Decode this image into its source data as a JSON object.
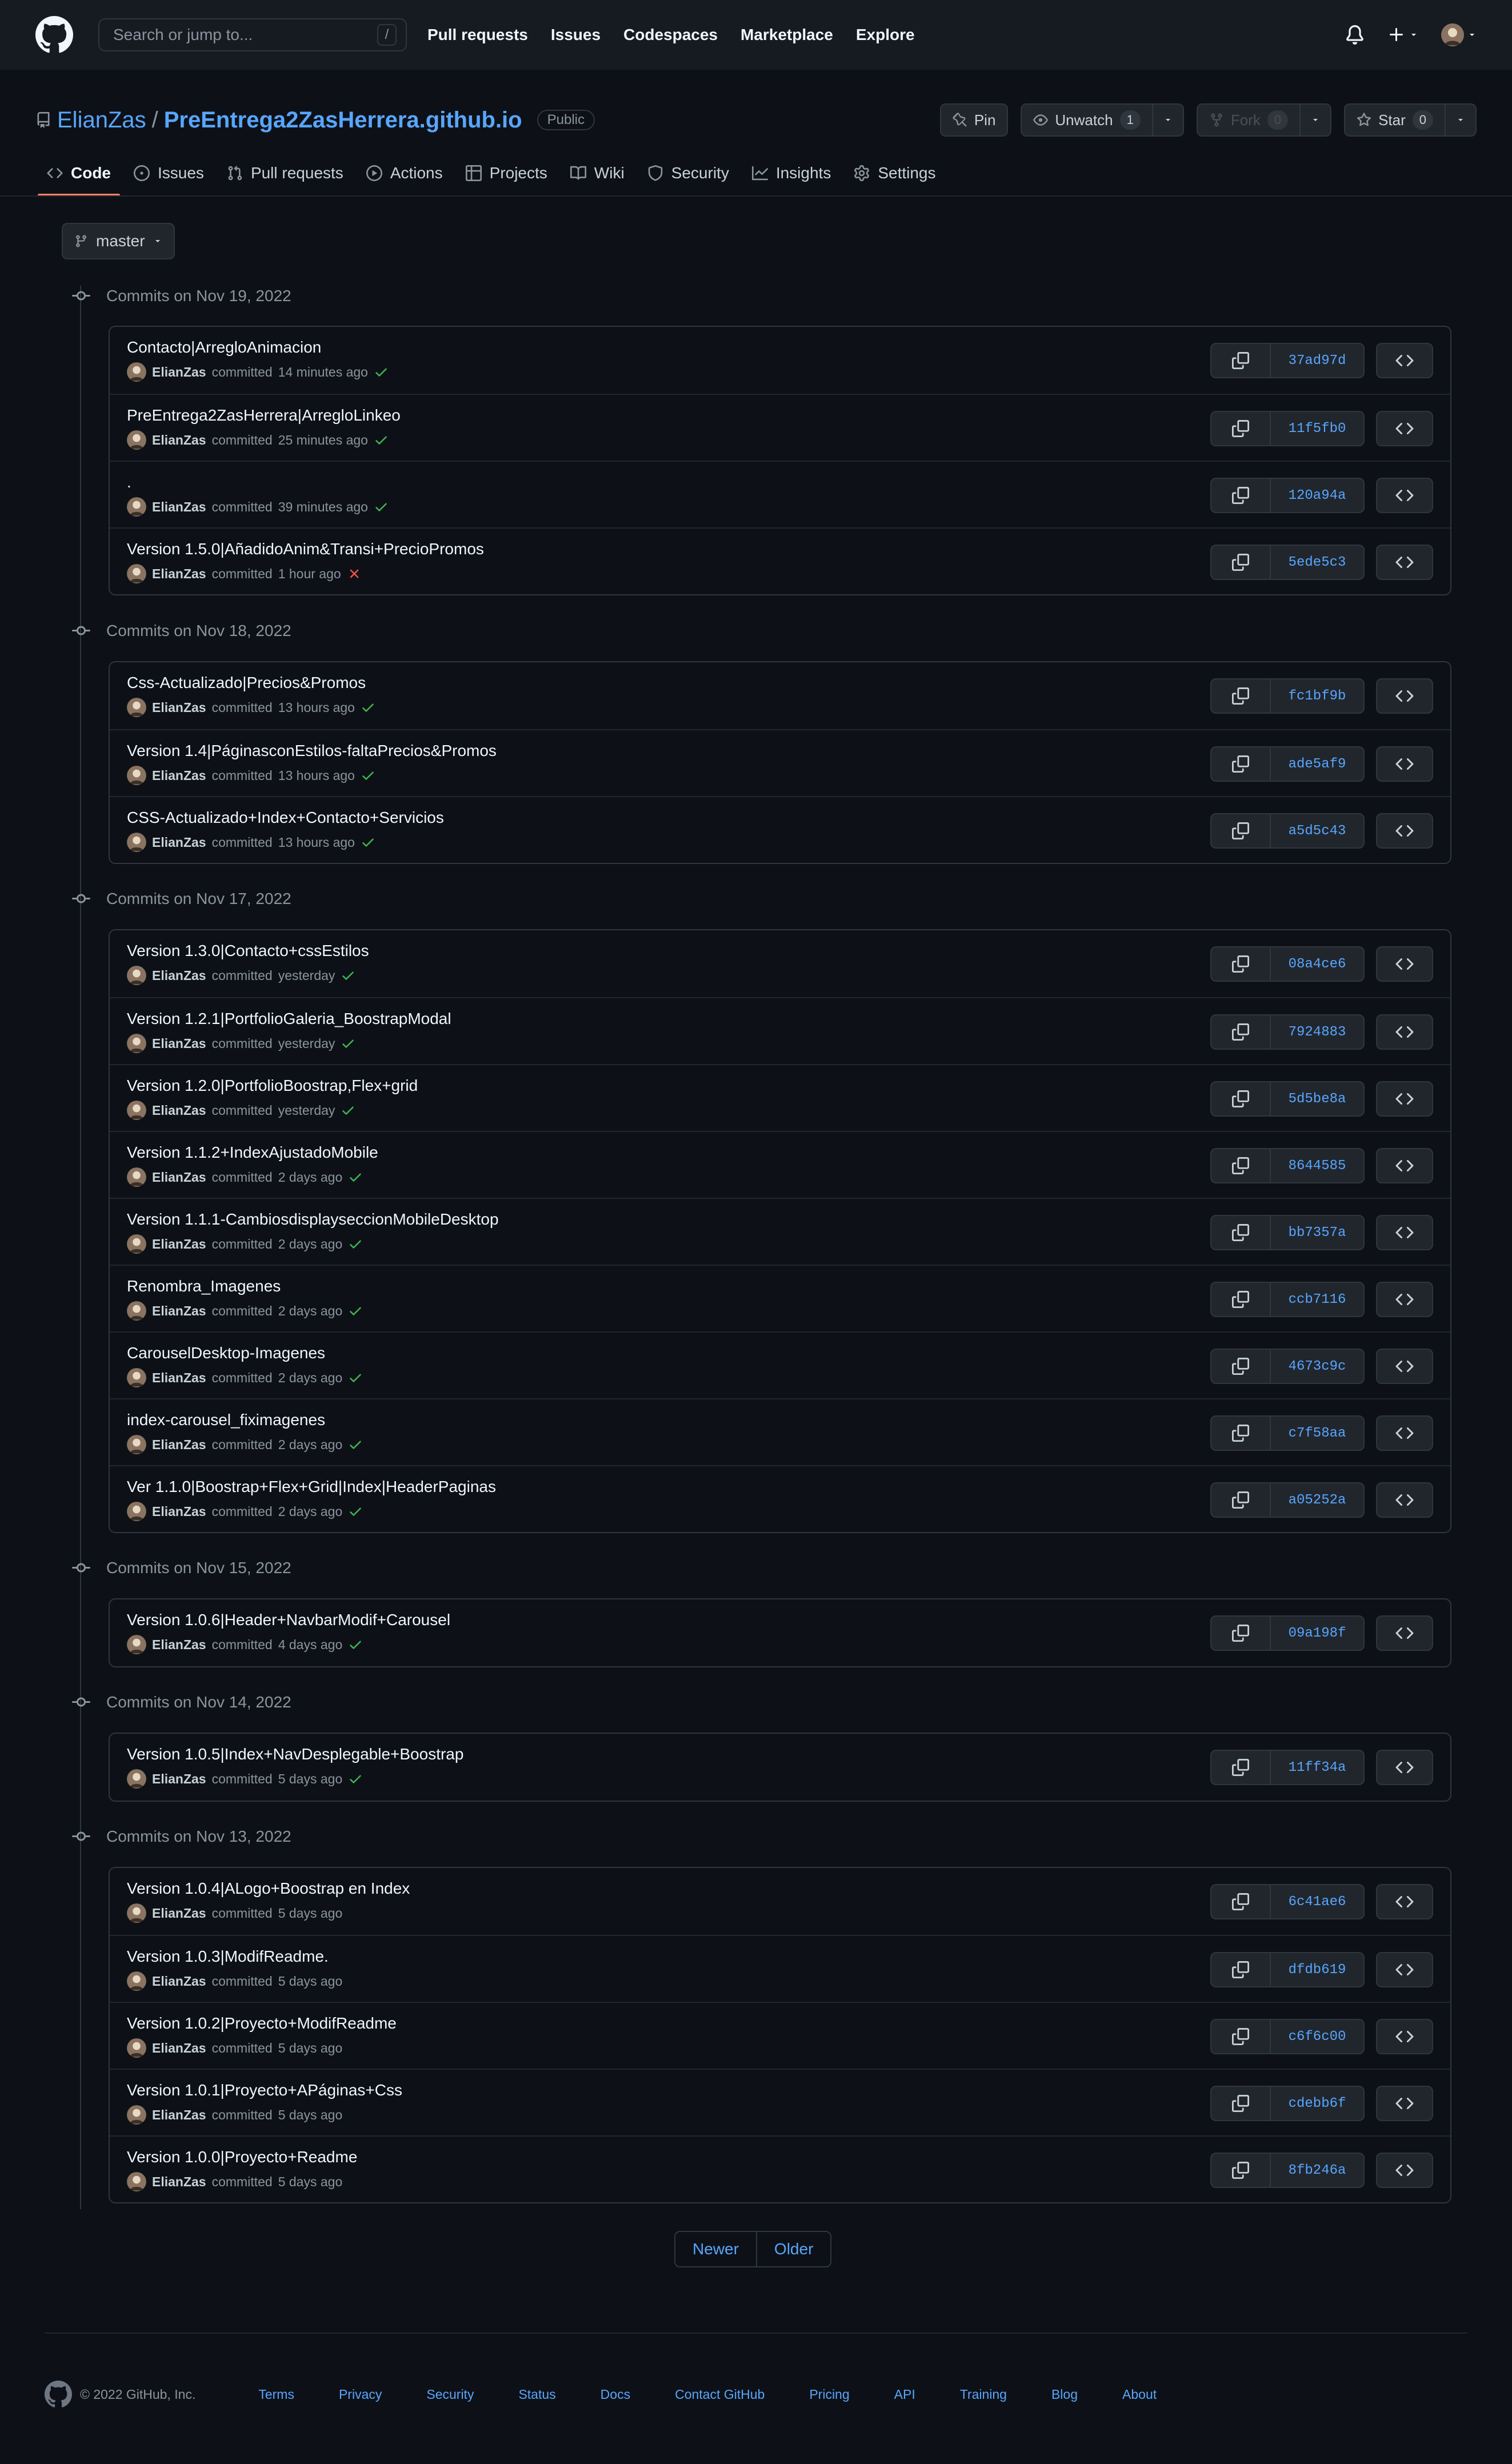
{
  "header": {
    "search_placeholder": "Search or jump to...",
    "search_shortcut": "/",
    "nav": [
      "Pull requests",
      "Issues",
      "Codespaces",
      "Marketplace",
      "Explore"
    ]
  },
  "repo": {
    "owner": "ElianZas",
    "separator": "/",
    "name": "PreEntrega2ZasHerrera.github.io",
    "visibility": "Public",
    "pin_label": "Pin",
    "unwatch_label": "Unwatch",
    "unwatch_count": "1",
    "fork_label": "Fork",
    "fork_count": "0",
    "star_label": "Star",
    "star_count": "0"
  },
  "tabs": [
    {
      "label": "Code",
      "icon": "code-icon"
    },
    {
      "label": "Issues",
      "icon": "issue-icon"
    },
    {
      "label": "Pull requests",
      "icon": "pull-request-icon"
    },
    {
      "label": "Actions",
      "icon": "play-icon"
    },
    {
      "label": "Projects",
      "icon": "table-icon"
    },
    {
      "label": "Wiki",
      "icon": "book-icon"
    },
    {
      "label": "Security",
      "icon": "shield-icon"
    },
    {
      "label": "Insights",
      "icon": "graph-icon"
    },
    {
      "label": "Settings",
      "icon": "gear-icon"
    }
  ],
  "branch": "master",
  "groups": [
    {
      "title": "Commits on Nov 19, 2022",
      "commits": [
        {
          "msg": "Contacto|ArregloAnimacion",
          "author": "ElianZas",
          "verb": "committed",
          "time": "14 minutes ago",
          "status": "ok",
          "sha": "37ad97d"
        },
        {
          "msg": "PreEntrega2ZasHerrera|ArregloLinkeo",
          "author": "ElianZas",
          "verb": "committed",
          "time": "25 minutes ago",
          "status": "ok",
          "sha": "11f5fb0"
        },
        {
          "msg": ".",
          "author": "ElianZas",
          "verb": "committed",
          "time": "39 minutes ago",
          "status": "ok",
          "sha": "120a94a"
        },
        {
          "msg": "Version 1.5.0|AñadidoAnim&Transi+PrecioPromos",
          "author": "ElianZas",
          "verb": "committed",
          "time": "1 hour ago",
          "status": "fail",
          "sha": "5ede5c3"
        }
      ]
    },
    {
      "title": "Commits on Nov 18, 2022",
      "commits": [
        {
          "msg": "Css-Actualizado|Precios&Promos",
          "author": "ElianZas",
          "verb": "committed",
          "time": "13 hours ago",
          "status": "ok",
          "sha": "fc1bf9b"
        },
        {
          "msg": "Version 1.4|PáginasconEstilos-faltaPrecios&Promos",
          "author": "ElianZas",
          "verb": "committed",
          "time": "13 hours ago",
          "status": "ok",
          "sha": "ade5af9"
        },
        {
          "msg": "CSS-Actualizado+Index+Contacto+Servicios",
          "author": "ElianZas",
          "verb": "committed",
          "time": "13 hours ago",
          "status": "ok",
          "sha": "a5d5c43"
        }
      ]
    },
    {
      "title": "Commits on Nov 17, 2022",
      "commits": [
        {
          "msg": "Version 1.3.0|Contacto+cssEstilos",
          "author": "ElianZas",
          "verb": "committed",
          "time": "yesterday",
          "status": "ok",
          "sha": "08a4ce6"
        },
        {
          "msg": "Version 1.2.1|PortfolioGaleria_BoostrapModal",
          "author": "ElianZas",
          "verb": "committed",
          "time": "yesterday",
          "status": "ok",
          "sha": "7924883"
        },
        {
          "msg": "Version 1.2.0|PortfolioBoostrap,Flex+grid",
          "author": "ElianZas",
          "verb": "committed",
          "time": "yesterday",
          "status": "ok",
          "sha": "5d5be8a"
        },
        {
          "msg": "Version 1.1.2+IndexAjustadoMobile",
          "author": "ElianZas",
          "verb": "committed",
          "time": "2 days ago",
          "status": "ok",
          "sha": "8644585"
        },
        {
          "msg": "Version 1.1.1-CambiosdisplayseccionMobileDesktop",
          "author": "ElianZas",
          "verb": "committed",
          "time": "2 days ago",
          "status": "ok",
          "sha": "bb7357a"
        },
        {
          "msg": "Renombra_Imagenes",
          "author": "ElianZas",
          "verb": "committed",
          "time": "2 days ago",
          "status": "ok",
          "sha": "ccb7116"
        },
        {
          "msg": "CarouselDesktop-Imagenes",
          "author": "ElianZas",
          "verb": "committed",
          "time": "2 days ago",
          "status": "ok",
          "sha": "4673c9c"
        },
        {
          "msg": "index-carousel_fiximagenes",
          "author": "ElianZas",
          "verb": "committed",
          "time": "2 days ago",
          "status": "ok",
          "sha": "c7f58aa"
        },
        {
          "msg": "Ver 1.1.0|Boostrap+Flex+Grid|Index|HeaderPaginas",
          "author": "ElianZas",
          "verb": "committed",
          "time": "2 days ago",
          "status": "ok",
          "sha": "a05252a"
        }
      ]
    },
    {
      "title": "Commits on Nov 15, 2022",
      "commits": [
        {
          "msg": "Version 1.0.6|Header+NavbarModif+Carousel",
          "author": "ElianZas",
          "verb": "committed",
          "time": "4 days ago",
          "status": "ok",
          "sha": "09a198f"
        }
      ]
    },
    {
      "title": "Commits on Nov 14, 2022",
      "commits": [
        {
          "msg": "Version 1.0.5|Index+NavDesplegable+Boostrap",
          "author": "ElianZas",
          "verb": "committed",
          "time": "5 days ago",
          "status": "ok",
          "sha": "11ff34a"
        }
      ]
    },
    {
      "title": "Commits on Nov 13, 2022",
      "commits": [
        {
          "msg": "Version 1.0.4|ALogo+Boostrap en Index",
          "author": "ElianZas",
          "verb": "committed",
          "time": "5 days ago",
          "status": "none",
          "sha": "6c41ae6"
        },
        {
          "msg": "Version 1.0.3|ModifReadme.",
          "author": "ElianZas",
          "verb": "committed",
          "time": "5 days ago",
          "status": "none",
          "sha": "dfdb619"
        },
        {
          "msg": "Version 1.0.2|Proyecto+ModifReadme",
          "author": "ElianZas",
          "verb": "committed",
          "time": "5 days ago",
          "status": "none",
          "sha": "c6f6c00"
        },
        {
          "msg": "Version 1.0.1|Proyecto+APáginas+Css",
          "author": "ElianZas",
          "verb": "committed",
          "time": "5 days ago",
          "status": "none",
          "sha": "cdebb6f"
        },
        {
          "msg": "Version 1.0.0|Proyecto+Readme",
          "author": "ElianZas",
          "verb": "committed",
          "time": "5 days ago",
          "status": "none",
          "sha": "8fb246a"
        }
      ]
    }
  ],
  "pagination": {
    "newer": "Newer",
    "older": "Older"
  },
  "footer": {
    "copyright": "© 2022 GitHub, Inc.",
    "links": [
      "Terms",
      "Privacy",
      "Security",
      "Status",
      "Docs",
      "Contact GitHub",
      "Pricing",
      "API",
      "Training",
      "Blog",
      "About"
    ]
  },
  "colors": {
    "accent": "#58a6ff",
    "success": "#3fb950",
    "danger": "#f85149",
    "tab_underline": "#f78166"
  }
}
